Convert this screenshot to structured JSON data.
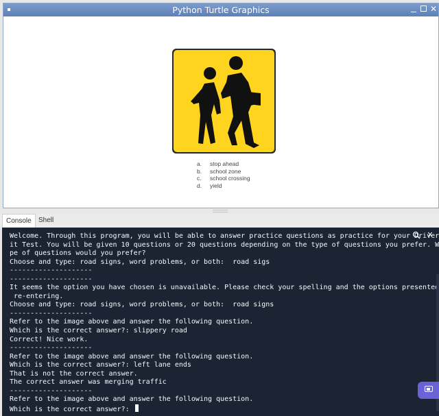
{
  "window": {
    "title": "Python Turtle Graphics"
  },
  "sign": {
    "icon": "school-crossing-sign",
    "colors": {
      "background": "#ffd41f",
      "border": "#2a2a1a",
      "figures": "#111111"
    }
  },
  "answers": [
    {
      "letter": "a.",
      "text": "stop ahead"
    },
    {
      "letter": "b.",
      "text": "school zone"
    },
    {
      "letter": "c.",
      "text": "school crossing"
    },
    {
      "letter": "d.",
      "text": "yield"
    }
  ],
  "tabs": [
    {
      "label": "Console"
    },
    {
      "label": "Shell"
    }
  ],
  "console": {
    "lines": [
      "Welcome. Through this program, you will be able to answer practice questions as practice for your Driver'",
      "it Test. You will be given 10 questions or 20 questions depending on the type of questions you prefer. Which ty",
      "pe of questions would you prefer?",
      "Choose and type: road signs, word problems, or both:  road sigs",
      "--------------------",
      "--------------------",
      "It seems the option you have chosen is unavailable. Please check your spelling and the options presented before",
      " re-entering.",
      "Choose and type: road signs, word problems, or both:  road signs",
      "--------------------",
      "Refer to the image above and answer the following question.",
      "Which is the correct answer?: slippery road",
      "Correct! Nice work.",
      "--------------------",
      "Refer to the image above and answer the following question.",
      "Which is the correct answer?: left lane ends",
      "That is not the correct answer.",
      "The correct answer was merging traffic",
      "--------------------",
      "Refer to the image above and answer the following question.",
      "Which is the correct answer?: "
    ]
  },
  "theme": {
    "console_bg": "#1c2333",
    "console_fg": "#f5f9fc",
    "titlebar": "#6a8bc2",
    "accent": "#6b62d6"
  }
}
